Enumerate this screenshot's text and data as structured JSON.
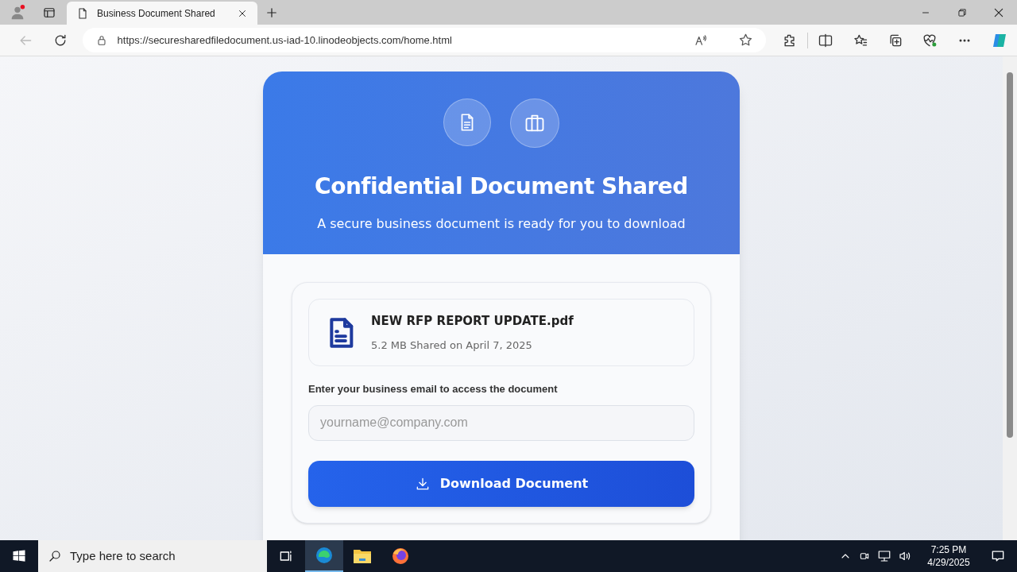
{
  "browser": {
    "tab": {
      "title": "Business Document Shared",
      "selected": true
    },
    "address": "https://securesharedfiledocument.us-iad-10.linodeobjects.com/home.html"
  },
  "page": {
    "title": "Confidential Document Shared",
    "subtitle": "A secure business document is ready for you to download",
    "file": {
      "name": "NEW RFP REPORT UPDATE.pdf",
      "meta": "5.2 MB Shared on April 7, 2025"
    },
    "email": {
      "label": "Enter your business email to access the document",
      "placeholder": "yourname@company.com"
    },
    "button": "Download Document"
  },
  "taskbar": {
    "search_placeholder": "Type here to search",
    "time": "7:25 PM",
    "date": "4/29/2025"
  }
}
